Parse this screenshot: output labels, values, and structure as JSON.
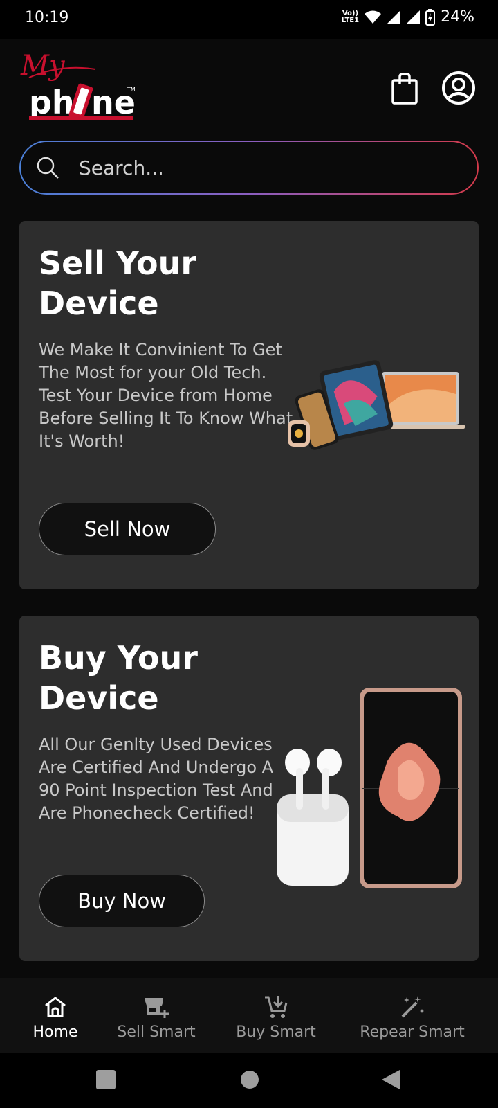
{
  "status": {
    "time": "10:19",
    "network_label": "Vo)) LTE1",
    "battery": "24%"
  },
  "header": {
    "logo_top": "My",
    "logo_main": "phone",
    "logo_tm": "TM",
    "icons": [
      "shopping-bag-icon",
      "account-circle-icon"
    ]
  },
  "search": {
    "placeholder": "Search..."
  },
  "sell_card": {
    "title_line1": "Sell Your",
    "title_line2": "Device",
    "description": "We Make It Convinient To Get The Most for your Old Tech. Test Your Device from Home Before Selling It To Know What It's Worth!",
    "button_label": "Sell Now"
  },
  "buy_card": {
    "title_line1": "Buy Your",
    "title_line2": "Device",
    "description": "All Our Genlty Used Devices Are Certified And Undergo A 90 Point Inspection Test And Are Phonecheck Certified!",
    "button_label": "Buy Now"
  },
  "bottom_nav": {
    "items": [
      {
        "label": "Home",
        "icon": "home-icon",
        "active": true
      },
      {
        "label": "Sell Smart",
        "icon": "store-plus-icon",
        "active": false
      },
      {
        "label": "Buy Smart",
        "icon": "cart-download-icon",
        "active": false
      },
      {
        "label": "Repear Smart",
        "icon": "magic-wand-icon",
        "active": false
      }
    ]
  },
  "colors": {
    "background": "#0a0a0a",
    "card": "#2d2d2d",
    "search_gradient_start": "#4a7fd6",
    "search_gradient_end": "#d23a4a",
    "logo_red": "#c8102e"
  }
}
